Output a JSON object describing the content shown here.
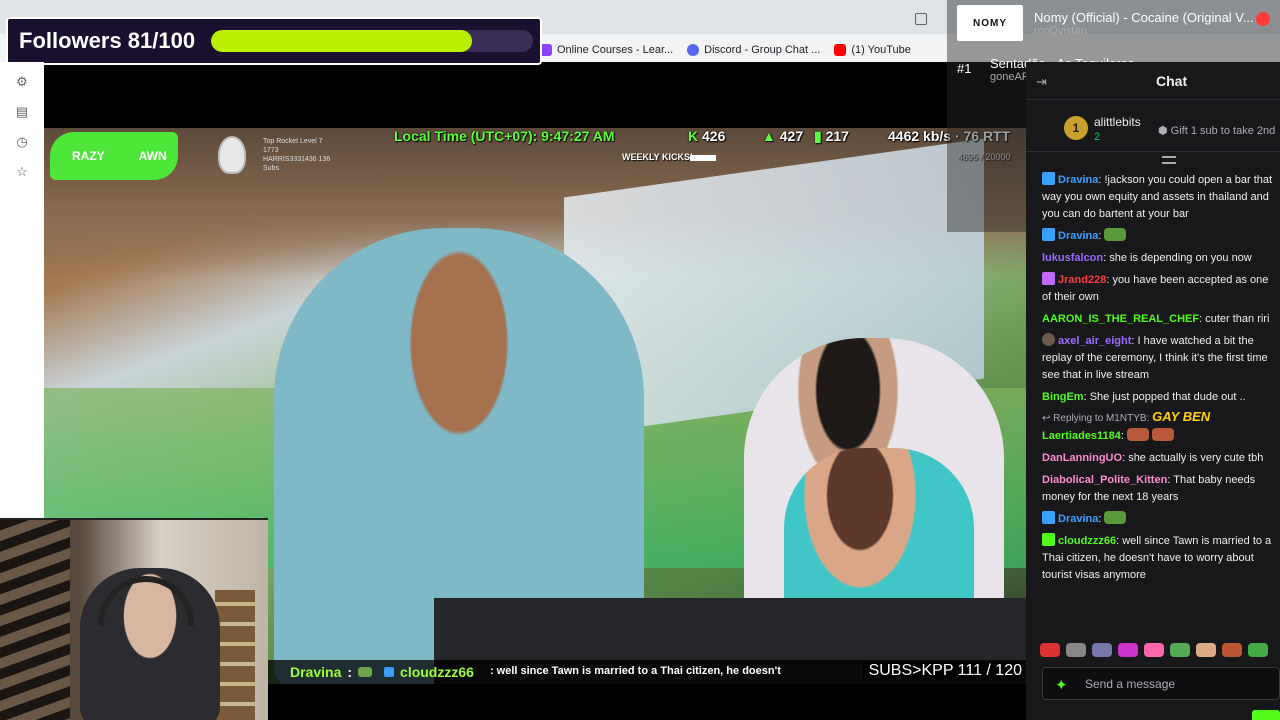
{
  "colors": {
    "accent_green": "#53fc18",
    "progress_fill": "#b8f000",
    "chat_bg": "#18181b"
  },
  "followers": {
    "label": "Followers 81/100",
    "current": 81,
    "goal": 100
  },
  "bookmarks": [
    {
      "label": "Online Courses - Lear...",
      "icon": "courses-icon",
      "color": "#8e44ff"
    },
    {
      "label": "Discord - Group Chat ...",
      "icon": "discord-icon",
      "color": "#5865f2"
    },
    {
      "label": "(1) YouTube",
      "icon": "youtube-icon",
      "color": "#ff0000"
    }
  ],
  "stream_hud": {
    "local_time": "Local Time (UTC+07): 9:47:27 AM",
    "stat_a": "426",
    "stat_b": "427",
    "stat_c": "217",
    "network": "4462 kb/s · 76 RTT",
    "weekly_kicks": "WEEKLY KICKS!",
    "sub_progress": "4696 / 20000",
    "logo_left": "RAZY",
    "logo_right": "AWN",
    "rocket_text": "Top Rocket Level 7 1773 HARRIS3331436 136 Subs"
  },
  "ticker": {
    "user1": "Dravina",
    "user2": "cloudzzz66",
    "message": ": well since Tawn is married to a Thai citizen, he doesn't",
    "subs": "SUBS>KPP  111 / 120"
  },
  "now_playing": {
    "art_label": "NOMY",
    "title": "Nomy (Official) - Cocaine (Original V...",
    "artist": "moQvistan",
    "rank": "#1",
    "next_title": "Sentadão - As Tequileras",
    "next_artist": "goneAFK"
  },
  "chat": {
    "title": "Chat",
    "gifter": {
      "rank": "1",
      "name": "alittlebits",
      "count": "2",
      "prompt": "Gift 1 sub to take 2nd"
    },
    "messages": [
      {
        "user": "Dravina",
        "color": "#3aa0ff",
        "text": "!jackson you could open a bar that way you own equity and assets in thailand and you can do bartent at your bar"
      },
      {
        "user": "Dravina",
        "color": "#3aa0ff",
        "text": ""
      },
      {
        "user": "lukusfalcon",
        "color": "#9b6cff",
        "text": "she is depending on you now"
      },
      {
        "user": "Jrand228",
        "color": "#ff3b3b",
        "text": "you have been accepted as one of their own"
      },
      {
        "user": "AARON_IS_THE_REAL_CHEF",
        "color": "#53fc18",
        "text": "cuter than riri"
      },
      {
        "user": "axel_air_eight",
        "color": "#9b6cff",
        "text": "I have watched a bit the replay of the ceremony, I think it's the first time see that in live stream"
      },
      {
        "user": "BingEm",
        "color": "#53fc18",
        "text": "She just popped that dude out .."
      },
      {
        "user": "Laertiades1184",
        "color": "#53fc18",
        "text": ""
      },
      {
        "user": "DanLanningUO",
        "color": "#ff8ad1",
        "text": "she actually is very cute tbh"
      },
      {
        "user": "Diabolical_Polite_Kitten",
        "color": "#ff8ad1",
        "text": "That baby needs money for the next 18 years"
      },
      {
        "user": "Dravina",
        "color": "#3aa0ff",
        "text": ""
      },
      {
        "user": "cloudzzz66",
        "color": "#53fc18",
        "text": "well since Tawn is married to a Thai citizen, he doesn't have to worry about tourist visas anymore"
      }
    ],
    "reply_label": "Replying to M1NTYB:",
    "reply_emote": "GAY BEN",
    "send_placeholder": "Send a message"
  }
}
